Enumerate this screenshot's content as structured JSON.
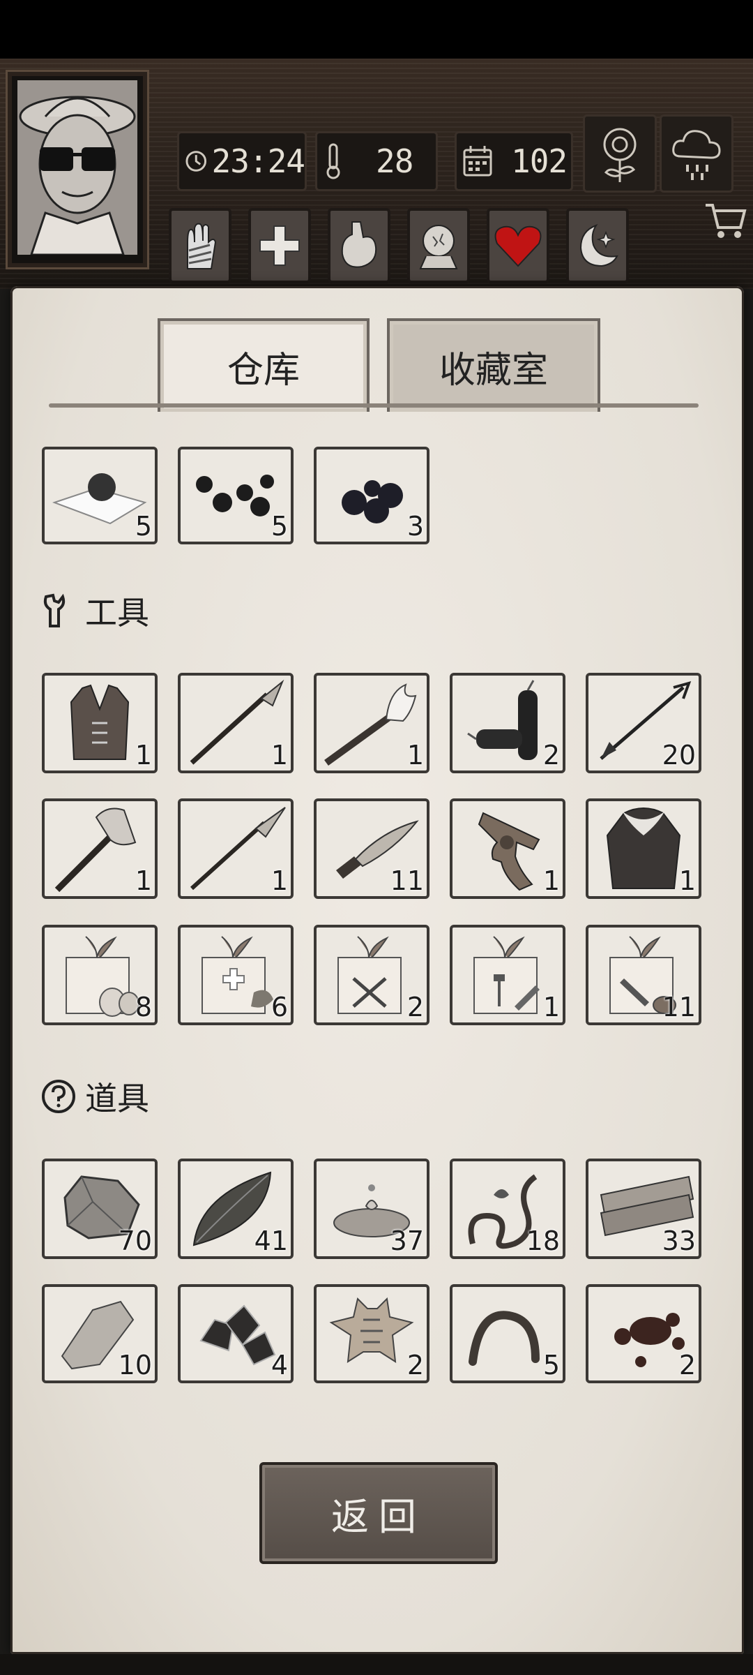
{
  "header": {
    "time": "23:24",
    "temperature": "28",
    "day": "102"
  },
  "status_icons": [
    "hand-bandage-icon",
    "medical-cross-icon",
    "stomach-icon",
    "head-brain-icon",
    "heart-icon",
    "moon-star-icon"
  ],
  "tabs": {
    "warehouse": "仓库",
    "collection": "收藏室"
  },
  "top_row": [
    "5",
    "5",
    "3"
  ],
  "sections": {
    "tools": "工具",
    "props": "道具"
  },
  "tools": [
    "1",
    "1",
    "1",
    "2",
    "20",
    "1",
    "1",
    "11",
    "1",
    "1",
    "8",
    "6",
    "2",
    "1",
    "11"
  ],
  "props": [
    "70",
    "41",
    "37",
    "18",
    "33",
    "10",
    "4",
    "2",
    "5",
    "2"
  ],
  "back_button": "返回"
}
